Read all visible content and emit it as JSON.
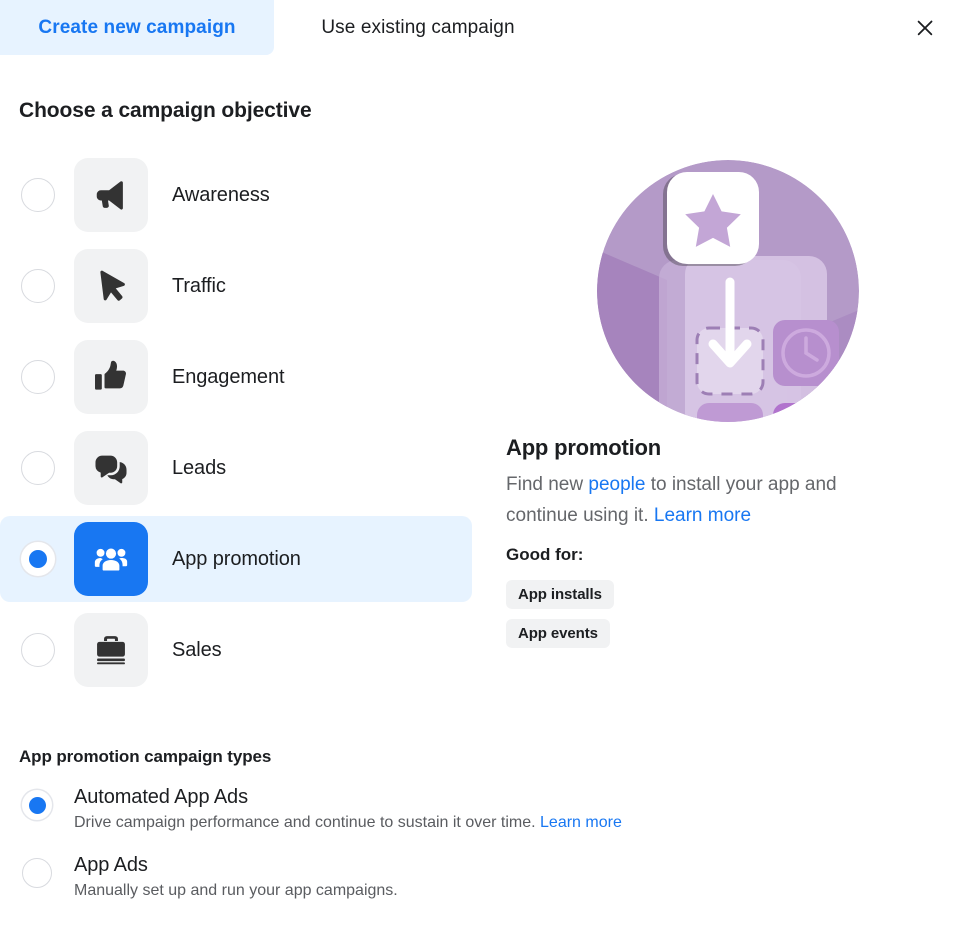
{
  "tabs": [
    {
      "id": "create-new",
      "label": "Create new campaign",
      "active": true
    },
    {
      "id": "use-existing",
      "label": "Use existing campaign",
      "active": false
    }
  ],
  "close_label": "Close",
  "objective_section": {
    "heading": "Choose a campaign objective",
    "options": [
      {
        "label": "Awareness",
        "icon": "megaphone-icon",
        "selected": false
      },
      {
        "label": "Traffic",
        "icon": "cursor-icon",
        "selected": false
      },
      {
        "label": "Engagement",
        "icon": "thumbs-up-icon",
        "selected": false
      },
      {
        "label": "Leads",
        "icon": "speech-bubbles-icon",
        "selected": false
      },
      {
        "label": "App promotion",
        "icon": "people-group-icon",
        "selected": true
      },
      {
        "label": "Sales",
        "icon": "briefcase-icon",
        "selected": false
      }
    ]
  },
  "detail": {
    "illustration": "app-install-illustration",
    "title": "App promotion",
    "desc_part1": "Find new ",
    "desc_link1": "people",
    "desc_part2": " to install your app and continue using it. ",
    "desc_link2": "Learn more",
    "good_for_label": "Good for:",
    "tags": [
      "App installs",
      "App events"
    ]
  },
  "types_section": {
    "heading": "App promotion campaign types",
    "options": [
      {
        "label": "Automated App Ads",
        "desc": "Drive campaign performance and continue to sustain it over time. ",
        "link": "Learn more",
        "selected": true
      },
      {
        "label": "App Ads",
        "desc": "Manually set up and run your app campaigns.",
        "link": "",
        "selected": false
      }
    ]
  },
  "colors": {
    "accent_blue": "#1877f2",
    "selected_row_bg": "#e7f3ff",
    "tile_gray": "#f1f2f3",
    "text_primary": "#1c1e21",
    "text_secondary": "#65676b",
    "illustration_purple": "#b49ac8"
  }
}
